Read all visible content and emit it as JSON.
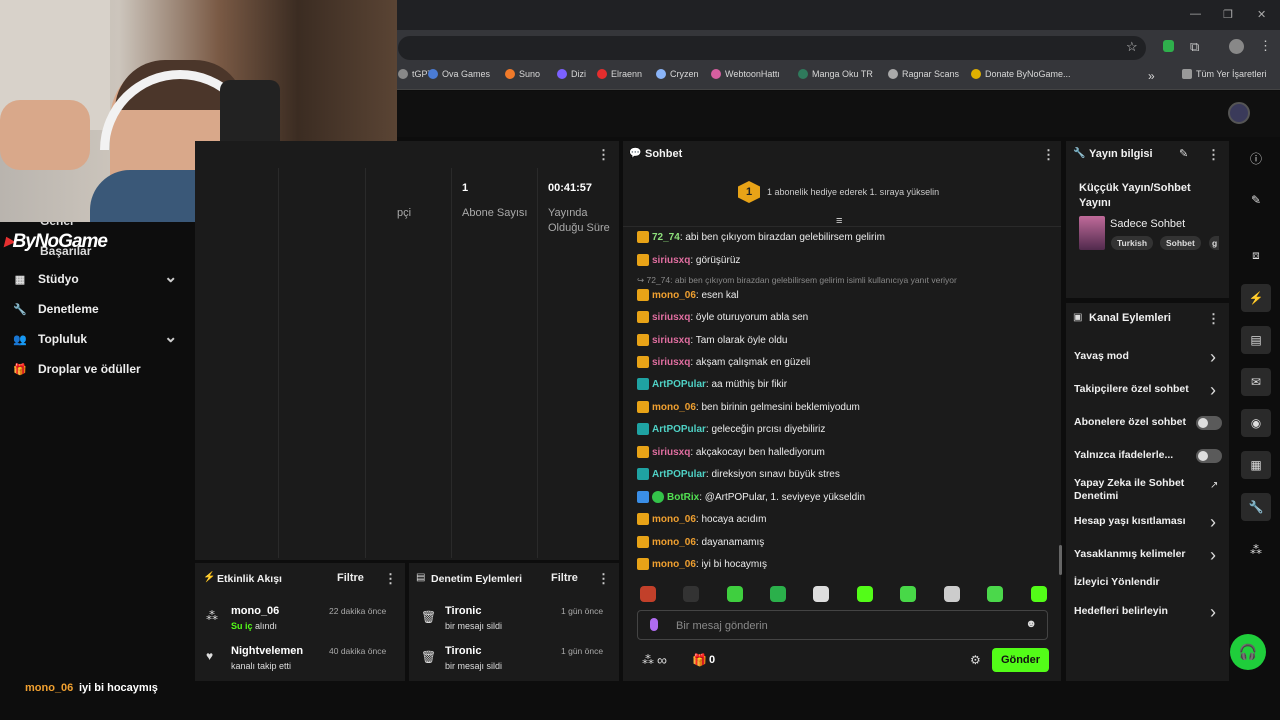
{
  "browser": {
    "bookmarks": [
      {
        "label": "tGPT",
        "color": "#888"
      },
      {
        "label": "Ova Games",
        "color": "#4a7bd4"
      },
      {
        "label": "Suno",
        "color": "#f07a2a"
      },
      {
        "label": "Dizi",
        "color": "#7b61ff"
      },
      {
        "label": "Elraenn",
        "color": "#e52d2d"
      },
      {
        "label": "Cryzen",
        "color": "#8ab4f8"
      },
      {
        "label": "WebtoonHattı",
        "color": "#d65fa0"
      },
      {
        "label": "Manga Oku TR",
        "color": "#2f7a5c"
      },
      {
        "label": "Ragnar Scans",
        "color": "#aaa"
      },
      {
        "label": "Donate ByNoGame...",
        "color": "#e0b000"
      }
    ],
    "bookmarks_more": "»",
    "all_bookmarks": "Tüm Yer İşaretleri",
    "window_controls": [
      "—",
      "❐",
      "✕"
    ]
  },
  "brand": {
    "logo_text": "ByNoGame"
  },
  "sidebar": {
    "items": [
      {
        "label": "Stüdyo",
        "icon": "studio-icon",
        "chevron": true
      },
      {
        "label": "Denetleme",
        "icon": "wrench-icon",
        "chevron": false
      },
      {
        "label": "Topluluk",
        "icon": "community-icon",
        "chevron": true
      },
      {
        "label": "Droplar ve ödüller",
        "icon": "drops-icon",
        "chevron": false
      }
    ],
    "partial_labels": [
      "Genel",
      "Başarılar"
    ]
  },
  "stats": {
    "partial_label": "pçi",
    "subs_value": "1",
    "subs_label": "Abone Sayısı",
    "uptime_value": "00:41:57",
    "uptime_label": "Yayında Olduğu Süre"
  },
  "chat": {
    "title": "Sohbet",
    "pinned_rank": "1",
    "pinned_text": "1 abonelik hediye ederek 1. sıraya yükselin",
    "messages": [
      {
        "user": "72_74",
        "color": "#8ee07b",
        "badge": "crown",
        "text": ": abi ben çıkıyom birazdan gelebilirsem gelirim"
      },
      {
        "user": "siriusxq",
        "color": "#e06ea0",
        "badge": "crown",
        "text": ": görüşürüz"
      },
      {
        "reply": "↪ 72_74: abi ben çıkıyom birazdan gelebilirsem gelirim isimli kullanıcıya yanıt veriyor"
      },
      {
        "user": "mono_06",
        "color": "#f0a030",
        "badge": "crown",
        "text": ": esen kal"
      },
      {
        "user": "siriusxq",
        "color": "#e06ea0",
        "badge": "crown",
        "text": ": öyle oturuyorum abla sen"
      },
      {
        "user": "siriusxq",
        "color": "#e06ea0",
        "badge": "crown",
        "text": ": Tam olarak öyle oldu"
      },
      {
        "user": "siriusxq",
        "color": "#e06ea0",
        "badge": "crown",
        "text": ": akşam çalışmak en güzeli"
      },
      {
        "user": "ArtPOPular",
        "color": "#4fd1c5",
        "badge": "teal",
        "text": ": aa müthiş bir fikir"
      },
      {
        "user": "mono_06",
        "color": "#f0a030",
        "badge": "crown",
        "text": ": ben birinin gelmesini beklemiyodum"
      },
      {
        "user": "ArtPOPular",
        "color": "#4fd1c5",
        "badge": "teal",
        "text": ": geleceğin prcısı diyebiliriz"
      },
      {
        "user": "siriusxq",
        "color": "#e06ea0",
        "badge": "crown",
        "text": ": akçakocayı ben hallediyorum"
      },
      {
        "user": "ArtPOPular",
        "color": "#4fd1c5",
        "badge": "teal",
        "text": ": direksiyon sınavı büyük stres"
      },
      {
        "user": "BotRix",
        "color": "#52e052",
        "badge": "bot",
        "text": ": @ArtPOPular, 1. seviyeye yükseldin"
      },
      {
        "user": "mono_06",
        "color": "#f0a030",
        "badge": "crown",
        "text": ": hocaya acıdım"
      },
      {
        "user": "mono_06",
        "color": "#f0a030",
        "badge": "crown",
        "text": ": dayanamamış"
      },
      {
        "user": "mono_06",
        "color": "#f0a030",
        "badge": "crown",
        "text": ": iyi bi hocaymış"
      }
    ],
    "input_placeholder": "Bir mesaj gönderin",
    "points_label": "∞",
    "gift_count": "0",
    "send_label": "Gönder"
  },
  "stream_info": {
    "title": "Yayın bilgisi",
    "stream_title": "Küççük Yayın/Sohbet Yayını",
    "category": "Sadece Sohbet",
    "tags": [
      "Turkish",
      "Sohbet",
      "g"
    ]
  },
  "channel_actions": {
    "title": "Kanal Eylemleri",
    "items": [
      {
        "label": "Yavaş mod",
        "kind": "chevron"
      },
      {
        "label": "Takipçilere özel sohbet",
        "kind": "chevron"
      },
      {
        "label": "Abonelere özel sohbet",
        "kind": "toggle"
      },
      {
        "label": "Yalnızca ifadelerle...",
        "kind": "toggle"
      },
      {
        "label": "Yapay Zeka ile Sohbet Denetimi",
        "kind": "external"
      },
      {
        "label": "Hesap yaşı kısıtlaması",
        "kind": "chevron"
      },
      {
        "label": "Yasaklanmış kelimeler",
        "kind": "chevron"
      },
      {
        "label": "İzleyici Yönlendir",
        "kind": "none"
      },
      {
        "label": "Hedefleri belirleyin",
        "kind": "chevron"
      }
    ]
  },
  "activity": {
    "title": "Etkinlik Akışı",
    "filter": "Filtre",
    "items": [
      {
        "name": "mono_06",
        "sub_highlight": "Su iç",
        "sub": " alındı",
        "time": "22 dakika önce"
      },
      {
        "name": "Nightvelemen",
        "sub_highlight": "",
        "sub": "kanalı takip etti",
        "time": "40 dakika önce"
      }
    ]
  },
  "moderation": {
    "title": "Denetim Eylemleri",
    "filter": "Filtre",
    "items": [
      {
        "name": "Tironic",
        "sub": "bir mesajı sildi",
        "time": "1 gün önce"
      },
      {
        "name": "Tironic",
        "sub": "bir mesajı sildi",
        "time": "1 gün önce"
      }
    ]
  },
  "overlay": {
    "user": "mono_06",
    "text": "iyi bi hocaymış"
  },
  "colors": {
    "accent": "#53fc18",
    "crown": "#e8a317"
  }
}
